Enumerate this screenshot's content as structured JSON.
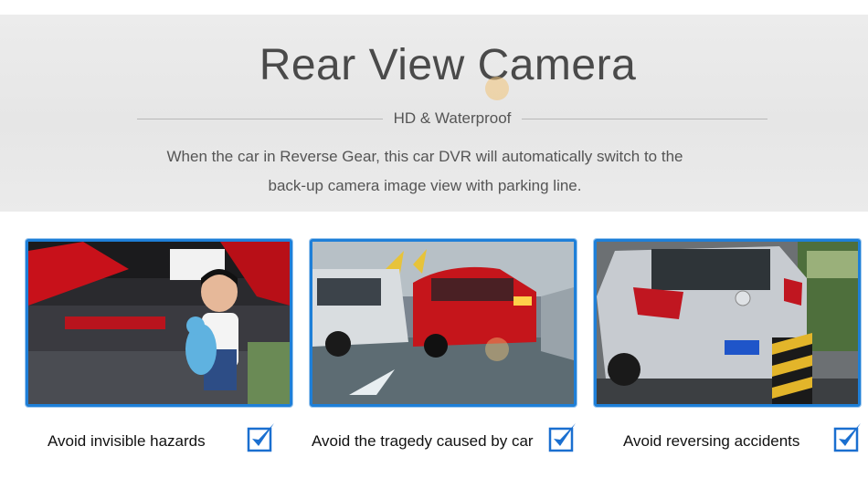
{
  "header": {
    "title": "Rear View Camera",
    "subtitle": "HD & Waterproof",
    "description_line1": "When the car in Reverse Gear, this car DVR will automatically switch to the",
    "description_line2": "back-up camera image view with parking line."
  },
  "features": [
    {
      "caption": "Avoid invisible hazards",
      "checked": true
    },
    {
      "caption": "Avoid the tragedy caused by car",
      "checked": true
    },
    {
      "caption": "Avoid reversing accidents",
      "checked": true
    }
  ],
  "colors": {
    "frame_blue": "#1e7fd8",
    "check_blue": "#1a6fd0",
    "text_gray": "#555555"
  },
  "icons": [
    "checkbox-checked-icon"
  ]
}
